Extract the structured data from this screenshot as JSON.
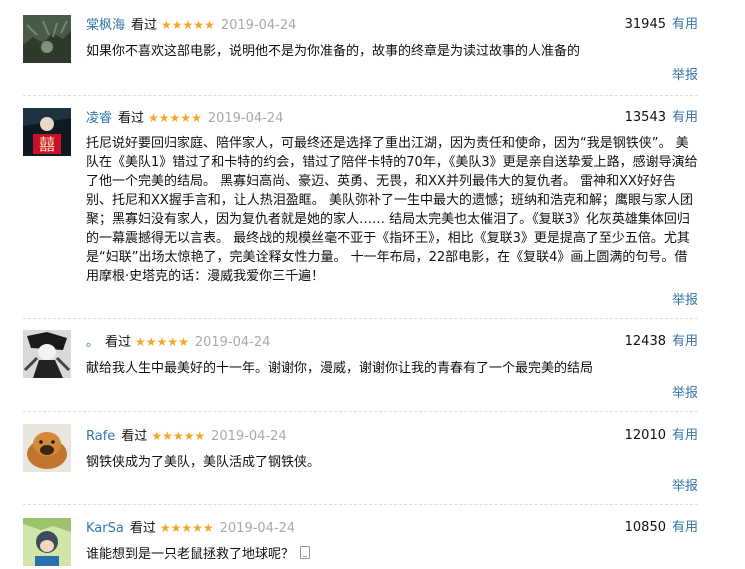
{
  "comments": [
    {
      "username": "棠枫海",
      "watched": "看过",
      "stars": "★★★★★",
      "date": "2019-04-24",
      "votes": "31945",
      "useful": "有用",
      "text": "如果你不喜欢这部电影，说明他不是为你准备的，故事的终章是为读过故事的人准备的",
      "report": "举报"
    },
    {
      "username": "凌睿",
      "watched": "看过",
      "stars": "★★★★★",
      "date": "2019-04-24",
      "votes": "13543",
      "useful": "有用",
      "text": "托尼说好要回归家庭、陪伴家人，可最终还是选择了重出江湖，因为责任和使命，因为“我是钢铁侠”。 美队在《美队1》错过了和卡特的约会，错过了陪伴卡特的70年，《美队3》更是亲自送挚爱上路，感谢导演给了他一个完美的结局。 黑寡妇高尚、豪迈、英勇、无畏，和XX并列最伟大的复仇者。 雷神和XX好好告别、托尼和XX握手言和，让人热泪盈眶。 美队弥补了一生中最大的遗憾；班纳和浩克和解；鹰眼与家人团聚；黑寡妇没有家人，因为复仇者就是她的家人…… 结局太完美也太催泪了。《复联3》化灰英雄集体回归的一幕震撼得无以言表。 最终战的规模丝毫不亚于《指环王》，相比《复联3》更是提高了至少五倍。尤其是“妇联”出场太惊艳了，完美诠释女性力量。 十一年布局，22部电影，在《复联4》画上圆满的句号。借用摩根·史塔克的话：漫威我爱你三千遍！",
      "report": "举报"
    },
    {
      "username": "。",
      "watched": "看过",
      "stars": "★★★★★",
      "date": "2019-04-24",
      "votes": "12438",
      "useful": "有用",
      "text": "献给我人生中最美好的十一年。谢谢你，漫威，谢谢你让我的青春有了一个最完美的结局",
      "report": "举报"
    },
    {
      "username": "Rafe",
      "watched": "看过",
      "stars": "★★★★★",
      "date": "2019-04-24",
      "votes": "12010",
      "useful": "有用",
      "text": "钢铁侠成为了美队，美队活成了钢铁侠。",
      "report": "举报"
    },
    {
      "username": "KarSa",
      "watched": "看过",
      "stars": "★★★★★",
      "date": "2019-04-24",
      "votes": "10850",
      "useful": "有用",
      "text": "谁能想到是一只老鼠拯救了地球呢？",
      "report": ""
    }
  ],
  "colors": {
    "link": "#3377aa",
    "star": "#f5a623",
    "date": "#aaaaaa"
  }
}
